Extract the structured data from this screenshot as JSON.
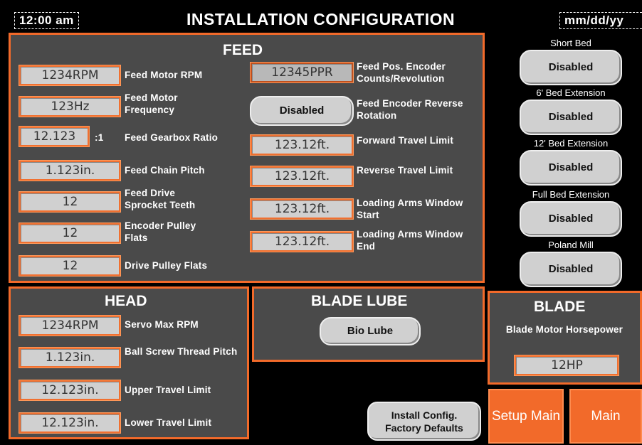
{
  "header": {
    "time": "12:00 am",
    "title": "INSTALLATION CONFIGURATION",
    "date": "mm/dd/yy"
  },
  "feed": {
    "title": "FEED",
    "left": [
      {
        "value": "1234RPM",
        "label": "Feed Motor RPM"
      },
      {
        "value": "123Hz",
        "label": "Feed Motor Frequency"
      },
      {
        "value": "12.123",
        "suffix": ":1",
        "label": "Feed Gearbox Ratio"
      },
      {
        "value": "1.123in.",
        "label": "Feed Chain Pitch"
      },
      {
        "value": "12",
        "label": "Feed Drive Sprocket Teeth"
      },
      {
        "value": "12",
        "label": "Encoder Pulley Flats"
      },
      {
        "value": "12",
        "label": "Drive Pulley Flats"
      }
    ],
    "right": [
      {
        "value": "12345PPR",
        "label": "Feed Pos. Encoder Counts/Revolution"
      },
      {
        "value": "Disabled",
        "label": "Feed Encoder Reverse Rotation"
      },
      {
        "value": "123.12ft.",
        "label": "Forward Travel Limit"
      },
      {
        "value": "123.12ft.",
        "label": "Reverse Travel Limit"
      },
      {
        "value": "123.12ft.",
        "label": "Loading Arms Window Start"
      },
      {
        "value": "123.12ft.",
        "label": "Loading Arms Window End"
      }
    ]
  },
  "head": {
    "title": "HEAD",
    "rows": [
      {
        "value": "1234RPM",
        "label": "Servo Max RPM"
      },
      {
        "value": "1.123in.",
        "label": "Ball Screw Thread Pitch"
      },
      {
        "value": "12.123in.",
        "label": "Upper Travel Limit"
      },
      {
        "value": "12.123in.",
        "label": "Lower Travel Limit"
      }
    ]
  },
  "blade_lube": {
    "title": "BLADE LUBE",
    "button": "Bio Lube"
  },
  "blade": {
    "title": "BLADE",
    "label": "Blade Motor Horsepower",
    "value": "12HP"
  },
  "side": [
    {
      "label": "Short Bed",
      "value": "Disabled"
    },
    {
      "label": "6' Bed Extension",
      "value": "Disabled"
    },
    {
      "label": "12' Bed Extension",
      "value": "Disabled"
    },
    {
      "label": "Full Bed Extension",
      "value": "Disabled"
    },
    {
      "label": "Poland Mill",
      "value": "Disabled"
    }
  ],
  "buttons": {
    "factory_defaults": "Install Config. Factory Defaults",
    "setup_main": "Setup Main",
    "main": "Main"
  },
  "colors": {
    "accent": "#f26a2a",
    "panel": "#4a4a4a",
    "field": "#d0d0d0",
    "background": "#000000"
  }
}
